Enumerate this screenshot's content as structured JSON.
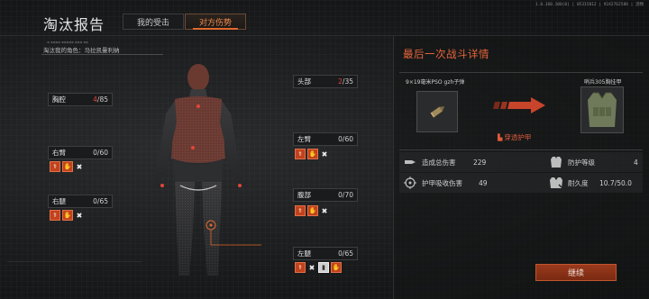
{
  "header": {
    "title": "淘汰报告",
    "version_info": "1.0.160.100(0) | 05315812 | 9242762588 | 流畅",
    "tabs": [
      {
        "label": "我的受击",
        "active": false
      },
      {
        "label": "对方伤势",
        "active": true
      }
    ]
  },
  "victim": {
    "label": "淘汰我的角色：马拉凯曼利纳"
  },
  "body_parts": [
    {
      "name": "胸腔",
      "current": "4",
      "max": "/85",
      "damaged": true
    },
    {
      "name": "头部",
      "current": "2",
      "max": "/35",
      "damaged": true
    },
    {
      "name": "右臂",
      "current": "0",
      "max": "/60",
      "damaged": false
    },
    {
      "name": "左臂",
      "current": "0",
      "max": "/60",
      "damaged": false
    },
    {
      "name": "右腿",
      "current": "0",
      "max": "/65",
      "damaged": false
    },
    {
      "name": "腹部",
      "current": "0",
      "max": "/70",
      "damaged": false
    },
    {
      "name": "左腿",
      "current": "0",
      "max": "/65",
      "damaged": false
    }
  ],
  "last_fight": {
    "title": "最后一次战斗详情",
    "ammo_name": "9×19毫米PSO gzh子弹",
    "armor_name": "哨兵305胸挂甲",
    "result": "穿透护甲",
    "stats": {
      "total_damage_label": "造成总伤害",
      "total_damage_value": "229",
      "armor_absorb_label": "护甲吸收伤害",
      "armor_absorb_value": "49",
      "protection_label": "防护等级",
      "protection_value": "4",
      "durability_label": "耐久度",
      "durability_value": "10.7/50.0"
    }
  },
  "footer": {
    "continue_label": "继续"
  },
  "colors": {
    "accent": "#e8663a",
    "damage_red": "#e0463a",
    "effect_orange": "#c2421c"
  }
}
